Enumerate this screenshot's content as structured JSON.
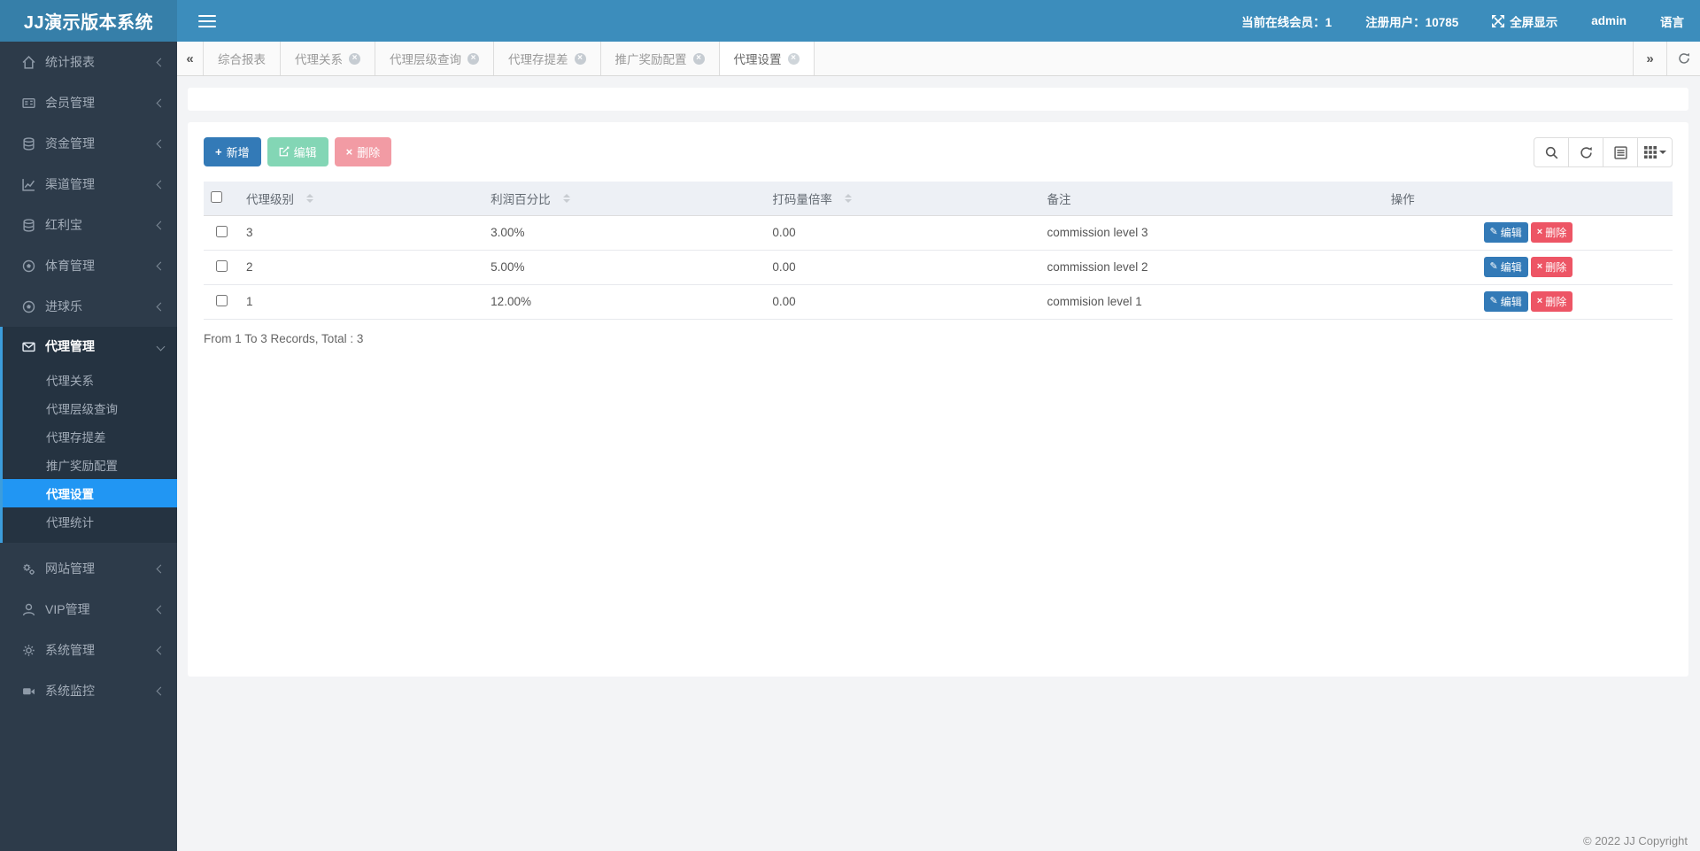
{
  "header": {
    "logo": "JJ演示版本系统",
    "online_members": "当前在线会员：1",
    "registered_users": "注册用户：10785",
    "fullscreen_label": "全屏显示",
    "username": "admin",
    "language_label": "语言"
  },
  "colors": {
    "header_bg": "#3c8dbc",
    "logo_bg": "#367fa9",
    "sidebar_bg": "#2d3b4a",
    "sidebar_group_bg": "#253341",
    "active_menu_bg": "#2196f3",
    "primary_button": "#337ab7",
    "danger_button": "#ed5565",
    "disabled_success": "#83d6b5",
    "disabled_danger": "#f29ba4",
    "table_header_bg": "#edf0f5"
  },
  "sidebar": {
    "items": [
      {
        "label": "统计报表",
        "icon": "home-icon"
      },
      {
        "label": "会员管理",
        "icon": "id-card-icon"
      },
      {
        "label": "资金管理",
        "icon": "database-icon"
      },
      {
        "label": "渠道管理",
        "icon": "line-chart-icon"
      },
      {
        "label": "红利宝",
        "icon": "database-icon"
      },
      {
        "label": "体育管理",
        "icon": "soccer-icon"
      },
      {
        "label": "进球乐",
        "icon": "soccer-icon"
      },
      {
        "label": "代理管理",
        "icon": "envelope-icon",
        "expanded": true,
        "children": [
          "代理关系",
          "代理层级查询",
          "代理存提差",
          "推广奖励配置",
          "代理设置",
          "代理统计"
        ],
        "active_child": "代理设置"
      },
      {
        "label": "网站管理",
        "icon": "gears-icon"
      },
      {
        "label": "VIP管理",
        "icon": "user-icon"
      },
      {
        "label": "系统管理",
        "icon": "gear-icon"
      },
      {
        "label": "系统监控",
        "icon": "video-camera-icon"
      }
    ]
  },
  "tabs": {
    "scroll_left_glyph": "«",
    "scroll_right_glyph": "»",
    "items": [
      {
        "label": "综合报表",
        "closable": false,
        "active": false
      },
      {
        "label": "代理关系",
        "closable": true,
        "active": false
      },
      {
        "label": "代理层级查询",
        "closable": true,
        "active": false
      },
      {
        "label": "代理存提差",
        "closable": true,
        "active": false
      },
      {
        "label": "推广奖励配置",
        "closable": true,
        "active": false
      },
      {
        "label": "代理设置",
        "closable": true,
        "active": true
      }
    ],
    "close_glyph": "×"
  },
  "toolbar": {
    "add_label": "新增",
    "add_icon_glyph": "+",
    "edit_label": "编辑",
    "delete_label": "删除",
    "delete_icon_glyph": "×"
  },
  "table": {
    "columns": [
      {
        "label": "代理级别",
        "sortable": true
      },
      {
        "label": "利润百分比",
        "sortable": true
      },
      {
        "label": "打码量倍率",
        "sortable": true
      },
      {
        "label": "备注",
        "sortable": false
      },
      {
        "label": "操作",
        "sortable": false
      }
    ],
    "rows": [
      {
        "level": "3",
        "profit": "3.00%",
        "rate": "0.00",
        "remark": "commission level 3"
      },
      {
        "level": "2",
        "profit": "5.00%",
        "rate": "0.00",
        "remark": "commission level 2"
      },
      {
        "level": "1",
        "profit": "12.00%",
        "rate": "0.00",
        "remark": "commision level 1"
      }
    ],
    "row_actions": {
      "edit": "编辑",
      "edit_glyph": "✎",
      "delete": "删除",
      "delete_glyph": "×"
    },
    "summary": "From 1 To 3 Records, Total : 3"
  },
  "footer": {
    "copyright": "© 2022 JJ Copyright"
  }
}
